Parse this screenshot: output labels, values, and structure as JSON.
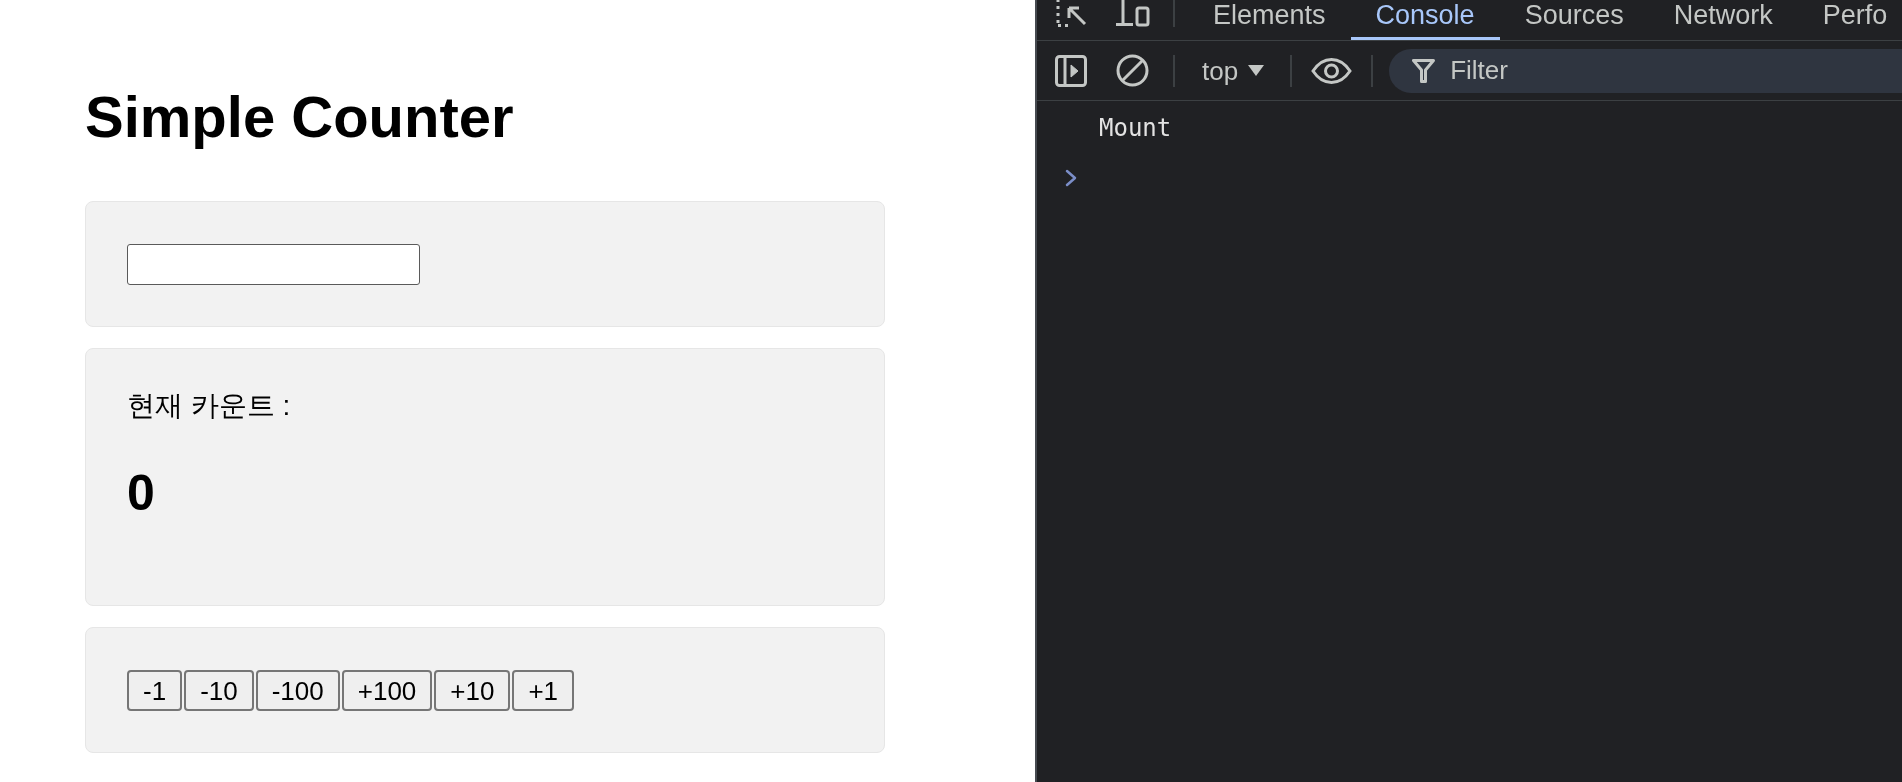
{
  "page": {
    "title": "Simple Counter"
  },
  "count_card": {
    "label": "현재 카운트 :",
    "value": "0"
  },
  "buttons": [
    {
      "label": "-1"
    },
    {
      "label": "-10"
    },
    {
      "label": "-100"
    },
    {
      "label": "+100"
    },
    {
      "label": "+10"
    },
    {
      "label": "+1"
    }
  ],
  "devtools": {
    "tabs": [
      {
        "label": "Elements",
        "selected": false
      },
      {
        "label": "Console",
        "selected": true
      },
      {
        "label": "Sources",
        "selected": false
      },
      {
        "label": "Network",
        "selected": false
      },
      {
        "label": "Perfo",
        "selected": false
      }
    ],
    "context_selector": {
      "value": "top"
    },
    "filter": {
      "placeholder": "Filter"
    },
    "console_messages": [
      {
        "text": "Mount"
      }
    ]
  }
}
